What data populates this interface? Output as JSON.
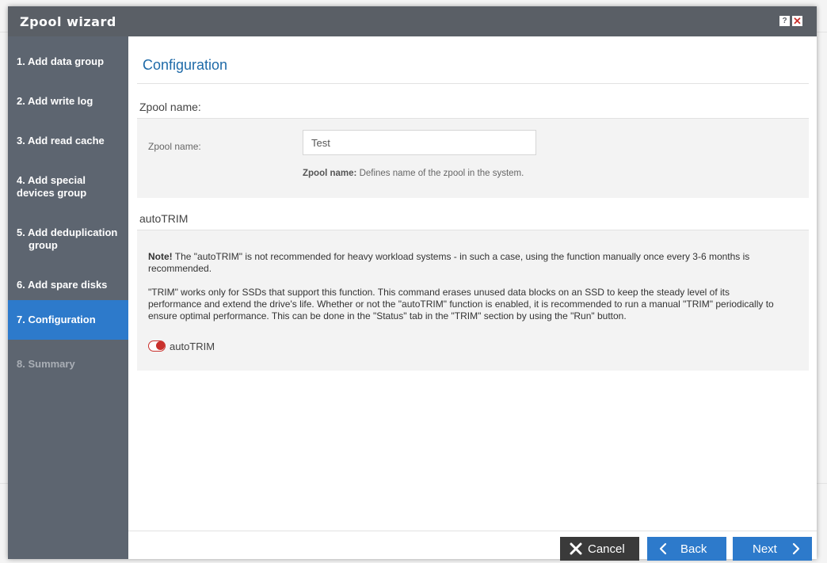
{
  "dialog": {
    "title": "Zpool wizard",
    "help_glyph": "?",
    "close_glyph": "✕"
  },
  "steps": [
    {
      "num_label": "1. Add data group"
    },
    {
      "num_label": "2. Add write log"
    },
    {
      "num_label": "3. Add read cache"
    },
    {
      "line1": "4. Add special",
      "line2": "devices group"
    },
    {
      "line1": "5. Add deduplication",
      "line2": "group"
    },
    {
      "num_label": "6. Add spare disks"
    },
    {
      "num_label": "7. Configuration"
    },
    {
      "num_label": "8. Summary"
    }
  ],
  "active_step": 7,
  "main": {
    "title": "Configuration",
    "zpool_section": {
      "heading": "Zpool name:",
      "field_label": "Zpool name:",
      "value": "Test",
      "help_bold": "Zpool name:",
      "help_text": " Defines name of the zpool in the system."
    },
    "autotrim_section": {
      "heading": "autoTRIM",
      "note_bold": "Note!",
      "note_text": " The \"autoTRIM\" is not recommended for heavy workload systems - in such a case, using the function manually once every 3-6 months is recommended.",
      "trim_text": "\"TRIM\" works only for SSDs that support this function. This command erases unused data blocks on an SSD to keep the steady level of its performance and extend the drive's life. Whether or not the \"autoTRIM\" function is enabled, it is recommended to run a manual \"TRIM\" periodically to ensure optimal performance. This can be done in the \"Status\" tab in the \"TRIM\" section by using the \"Run\" button.",
      "toggle_label": "autoTRIM",
      "toggle_on": false
    }
  },
  "footer": {
    "cancel_label": "Cancel",
    "back_label": "Back",
    "next_label": "Next"
  },
  "colors": {
    "accent": "#2d7acb",
    "sidebar": "#5d6570",
    "titlebar": "#5a5f66",
    "toggle_off": "#c9302c"
  }
}
